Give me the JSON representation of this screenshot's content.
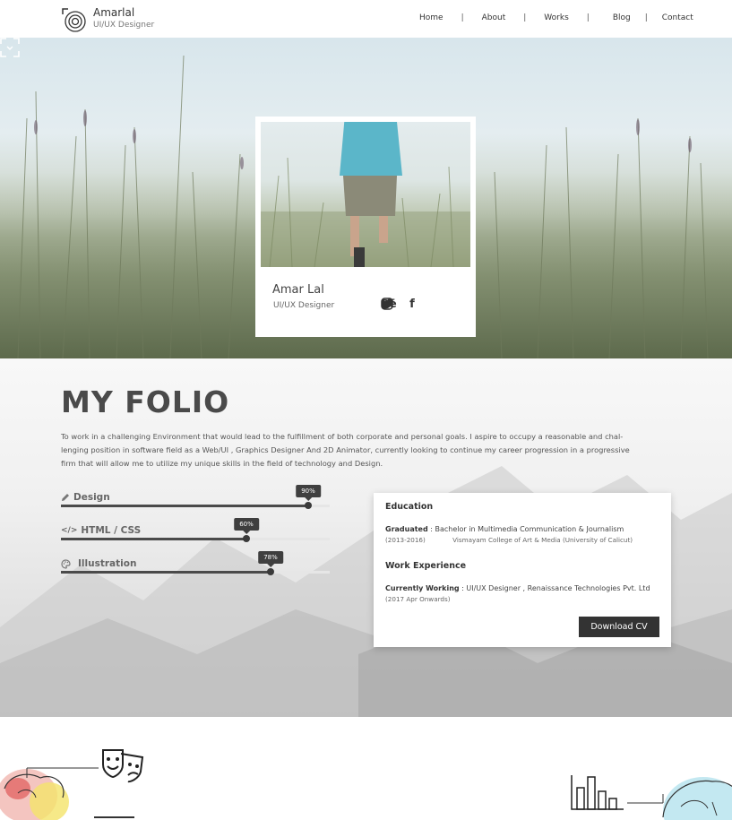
{
  "header": {
    "brand_name": "Amarlal",
    "brand_role": "UI/UX Designer",
    "nav": [
      "Home",
      "About",
      "Works",
      "Blog",
      "Contact"
    ],
    "separator": "|"
  },
  "hero": {
    "name": "Amar Lal",
    "role": "UI/UX Designer",
    "socials": [
      "behance-icon",
      "twitter-icon",
      "facebook-icon",
      "instagram-icon"
    ],
    "behance_glyph": "Bē",
    "facebook_glyph": "f"
  },
  "folio": {
    "title": "MY FOLIO",
    "description_lines": [
      "To work in a challenging Environment that would lead to the fulfillment of both corporate and personal goals. I aspire to occupy a reasonable and chal-",
      "lenging position in software field as a Web/UI , Graphics Designer And 2D Animator, currently looking to continue my career progression in a progressive",
      "firm that will allow me to utilize my unique skills in the field of technology and Design."
    ],
    "skills": [
      {
        "label": "Design",
        "percent_label": "90%",
        "value": 0.92
      },
      {
        "label": "HTML / CSS",
        "percent_label": "60%",
        "value": 0.69
      },
      {
        "label": "Illustration",
        "percent_label": "78%",
        "value": 0.78
      }
    ],
    "skill_prefix_html": "</>",
    "education": {
      "heading": "Education",
      "graduated_label": "Graduated",
      "graduated_text": " : Bachelor in Multimedia Communication & Journalism",
      "years": "(2013-2016)",
      "college": "Vismayam College of Art & Media (University of Calicut)"
    },
    "work": {
      "heading": "Work Experience",
      "current_label": "Currently Working",
      "current_text": " : UI/UX Designer , Renaissance Technologies Pvt. Ltd",
      "since": "(2017 Apr Onwards)"
    },
    "download_label": "Download CV"
  },
  "colors": {
    "accent": "#333333",
    "tooltip": "#3f3f3f"
  }
}
